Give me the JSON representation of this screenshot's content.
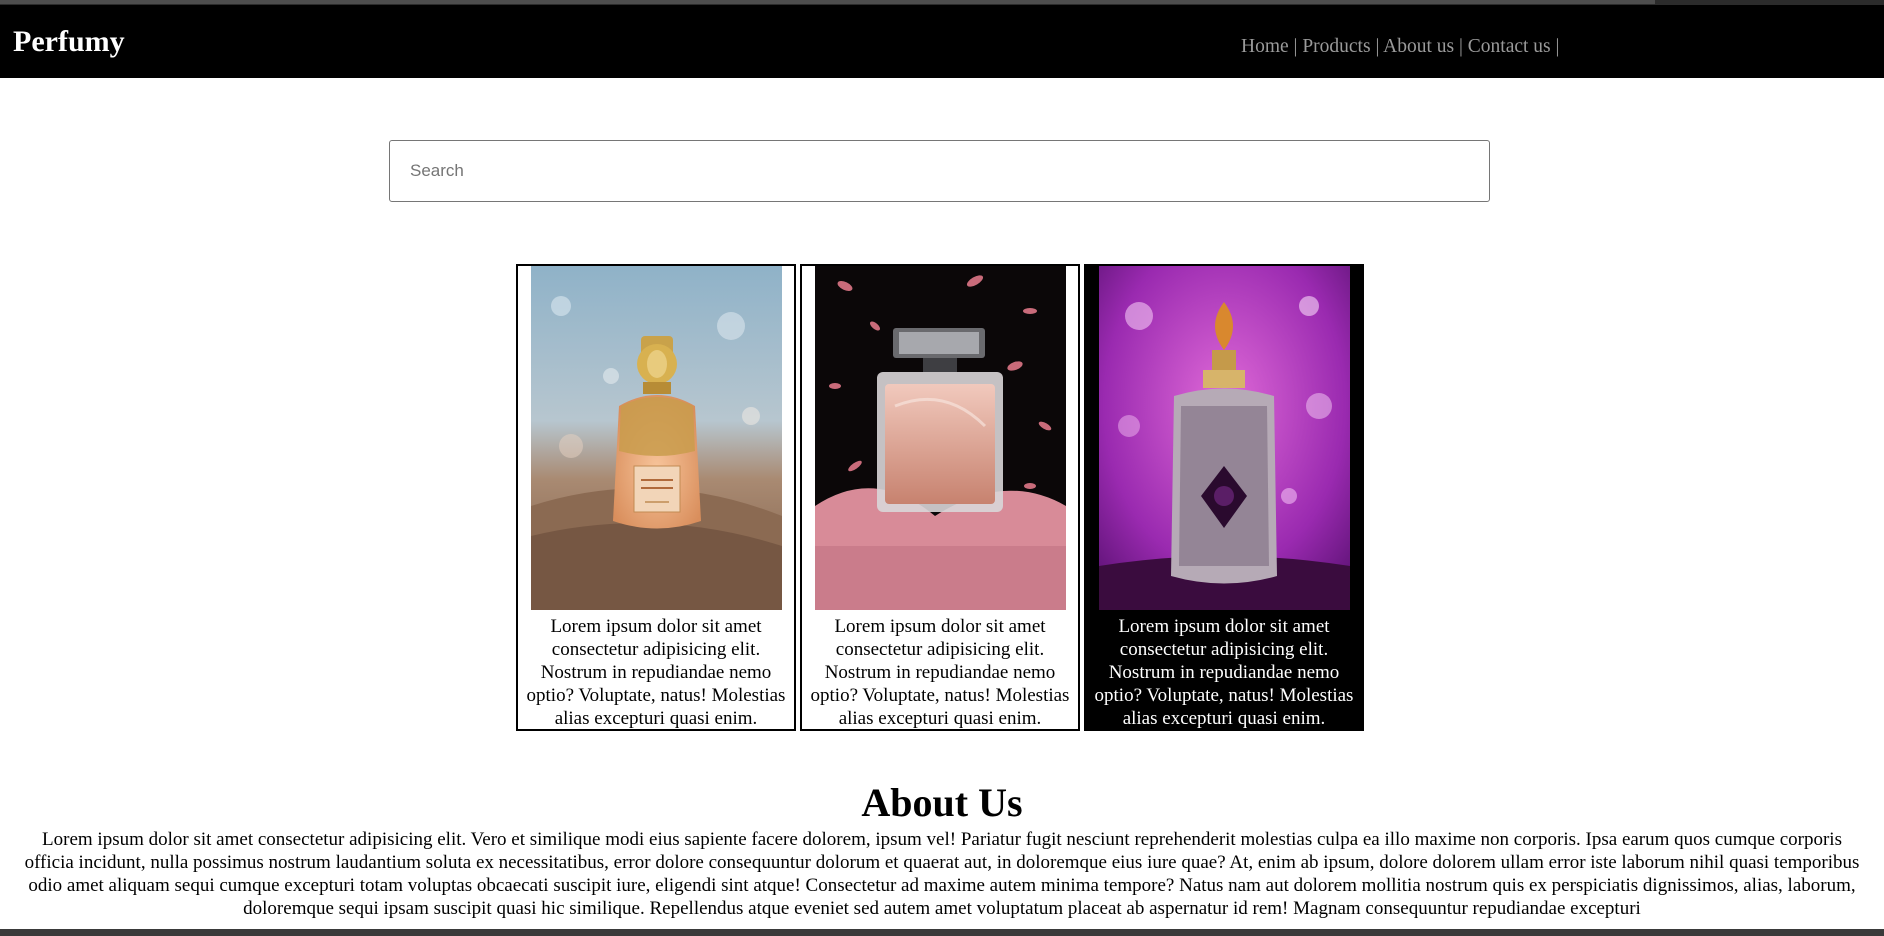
{
  "brand": "Perfumy",
  "nav": {
    "home": "Home",
    "products": "Products",
    "about": "About us",
    "contact": "Contact us",
    "separator": "|"
  },
  "search": {
    "placeholder": "Search",
    "value": ""
  },
  "products": [
    {
      "caption": "Lorem ipsum dolor sit amet consectetur adipisicing elit. Nostrum in repudiandae nemo optio? Voluptate, natus! Molestias alias excepturi quasi enim.",
      "image_icon": "golden-perfume-bottle-icon"
    },
    {
      "caption": "Lorem ipsum dolor sit amet consectetur adipisicing elit. Nostrum in repudiandae nemo optio? Voluptate, natus! Molestias alias excepturi quasi enim.",
      "image_icon": "pink-perfume-bottle-icon"
    },
    {
      "caption": "Lorem ipsum dolor sit amet consectetur adipisicing elit. Nostrum in repudiandae nemo optio? Voluptate, natus! Molestias alias excepturi quasi enim.",
      "image_icon": "ornate-perfume-bottle-icon"
    }
  ],
  "about": {
    "title": "About Us",
    "text": "Lorem ipsum dolor sit amet consectetur adipisicing elit. Vero et similique modi eius sapiente facere dolorem, ipsum vel! Pariatur fugit nesciunt reprehenderit molestias culpa ea illo maxime non corporis. Ipsa earum quos cumque corporis officia incidunt, nulla possimus nostrum laudantium soluta ex necessitatibus, error dolore consequuntur dolorum et quaerat aut, in doloremque eius iure quae? At, enim ab ipsum, dolore dolorem ullam error iste laborum nihil quasi temporibus odio amet aliquam sequi cumque excepturi totam voluptas obcaecati suscipit iure, eligendi sint atque! Consectetur ad maxime autem minima tempore? Natus nam aut dolorem mollitia nostrum quis ex perspiciatis dignissimos, alias, laborum, doloremque sequi ipsam suscipit quasi hic similique. Repellendus atque eveniet sed autem amet voluptatum placeat ab aspernatur id rem! Magnam consequuntur repudiandae excepturi"
  },
  "colors": {
    "navbar": "#000000",
    "nav_link": "#9a9a9a",
    "brand": "#ffffff"
  }
}
